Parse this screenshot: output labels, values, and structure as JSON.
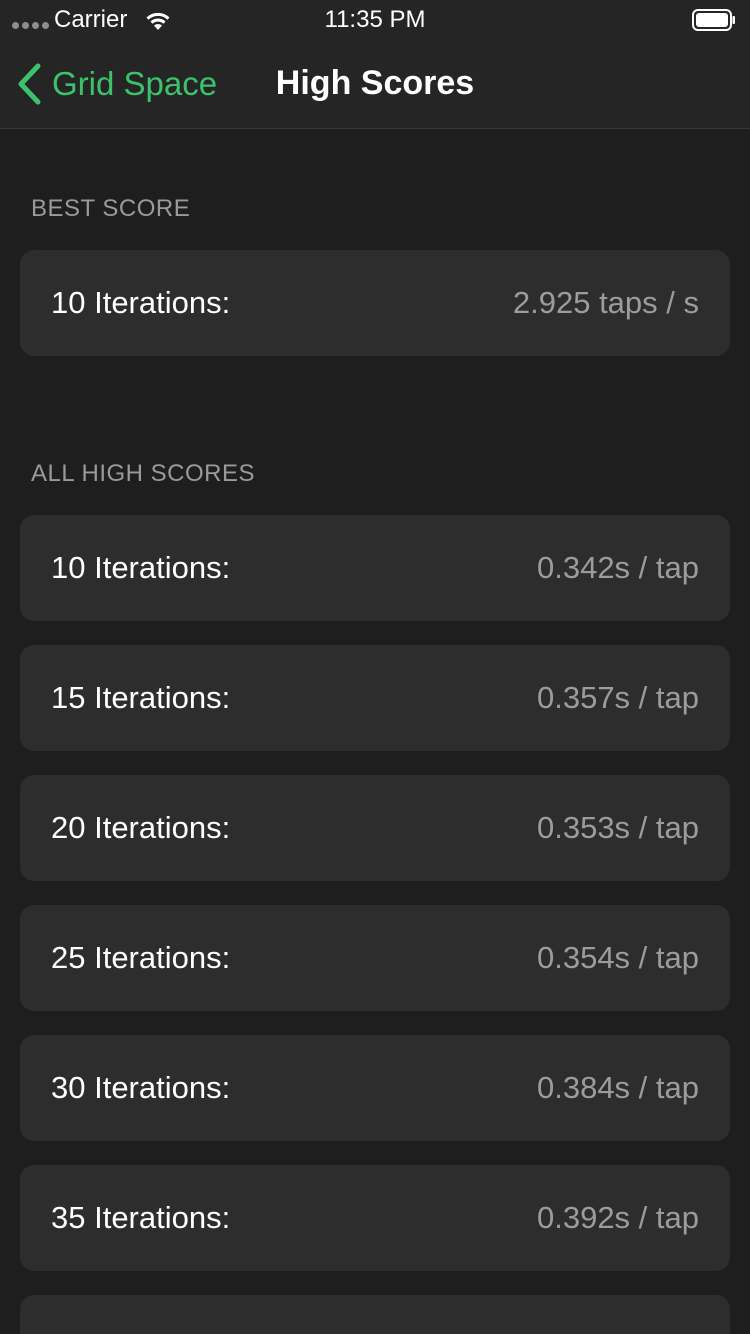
{
  "status_bar": {
    "carrier": "Carrier",
    "time": "11:35 PM"
  },
  "nav": {
    "back_label": "Grid Space",
    "title": "High Scores",
    "accent_color": "#3cc26a"
  },
  "best_score": {
    "header": "BEST SCORE",
    "row": {
      "label": "10 Iterations:",
      "value": "2.925 taps / s"
    }
  },
  "all_high_scores": {
    "header": "ALL HIGH SCORES",
    "rows": [
      {
        "label": "10 Iterations:",
        "value": "0.342s / tap"
      },
      {
        "label": "15 Iterations:",
        "value": "0.357s / tap"
      },
      {
        "label": "20 Iterations:",
        "value": "0.353s / tap"
      },
      {
        "label": "25 Iterations:",
        "value": "0.354s / tap"
      },
      {
        "label": "30 Iterations:",
        "value": "0.384s / tap"
      },
      {
        "label": "35 Iterations:",
        "value": "0.392s / tap"
      }
    ]
  }
}
